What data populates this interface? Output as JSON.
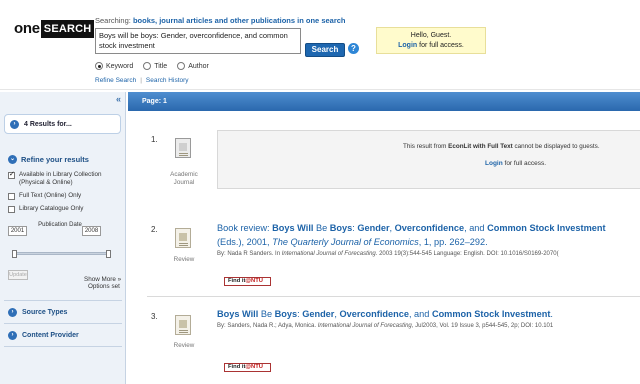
{
  "header": {
    "logo": {
      "one": "one",
      "search": "SEARCH"
    },
    "searching_prefix": "Searching:",
    "searching_scope": "books, journal articles and other publications in one search",
    "query": "Boys will be boys: Gender, overconfidence, and common stock investment",
    "search_button": "Search",
    "help_icon": "?",
    "radios": [
      {
        "label": "Keyword",
        "selected": true
      },
      {
        "label": "Title",
        "selected": false
      },
      {
        "label": "Author",
        "selected": false
      }
    ],
    "refine_search": "Refine Search",
    "separator": "|",
    "search_history": "Search History",
    "guest_greeting": "Hello, Guest.",
    "login_link": "Login",
    "login_suffix": " for full access."
  },
  "sidebar": {
    "collapse_icon": "«",
    "results_count": "4 Results for...",
    "refine_title": "Refine your results",
    "filters": [
      {
        "label": "Available in Library Collection (Physical & Online)",
        "checked": true
      },
      {
        "label": "Full Text (Online) Only",
        "checked": false
      },
      {
        "label": "Library Catalogue Only",
        "checked": false
      }
    ],
    "date_from": "2001",
    "date_to": "2008",
    "date_label": "Publication Date",
    "update_button": "Update",
    "show_more": "Show More »",
    "options_set": "Options set",
    "source_types": "Source Types",
    "content_provider": "Content Provider"
  },
  "main": {
    "page_label": "Page: 1",
    "results": [
      {
        "number": "1.",
        "type": "Academic Journal",
        "restricted_prefix": "This result from ",
        "restricted_source": "EconLit with Full Text",
        "restricted_suffix": " cannot be displayed to guests.",
        "login_link": "Login",
        "login_suffix": " for full access."
      },
      {
        "number": "2.",
        "type": "Review",
        "title_prefix": "Book review: ",
        "title_b1": "Boys Will",
        "title_m1": " Be ",
        "title_b2": "Boys",
        "title_m2": ": ",
        "title_b3": "Gender",
        "title_m3": ", ",
        "title_b4": "Overconfidence",
        "title_m4": ", and ",
        "title_b5": "Common Stock Investment",
        "line2_prefix": "(Eds.), 2001, ",
        "line2_journal": "The Quarterly Journal of Economics",
        "line2_suffix": ", 1, pp. 262–292.",
        "meta_prefix": "By: Nada R Sanders. In ",
        "meta_journal": "International Journal of Forecasting",
        "meta_suffix": ". 2003 19(3):544-545 Language: English. DOI: 10.1016/S0169-2070(",
        "findit": "Find it",
        "findit_ntu": "@NTU"
      },
      {
        "number": "3.",
        "type": "Review",
        "title_b1": "Boys Will",
        "title_m1": " Be ",
        "title_b2": "Boys",
        "title_m2": ": ",
        "title_b3": "Gender",
        "title_m3": ", ",
        "title_b4": "Overconfidence",
        "title_m4": ", and ",
        "title_b5": "Common Stock Investment",
        "title_end": ".",
        "meta_prefix": "By: Sanders, Nada R.; Adya, Monica. ",
        "meta_journal": "International Journal of Forecasting",
        "meta_suffix": ", Jul2003, Vol. 19 Issue 3, p544-545, 2p; DOI: 10.101",
        "findit": "Find it",
        "findit_ntu": "@NTU"
      }
    ]
  },
  "colors": {
    "accent": "#1d63a8",
    "page_bar": "#2a68ad",
    "guest_box": "#fffbcc",
    "sidebar": "#edf2f8"
  }
}
